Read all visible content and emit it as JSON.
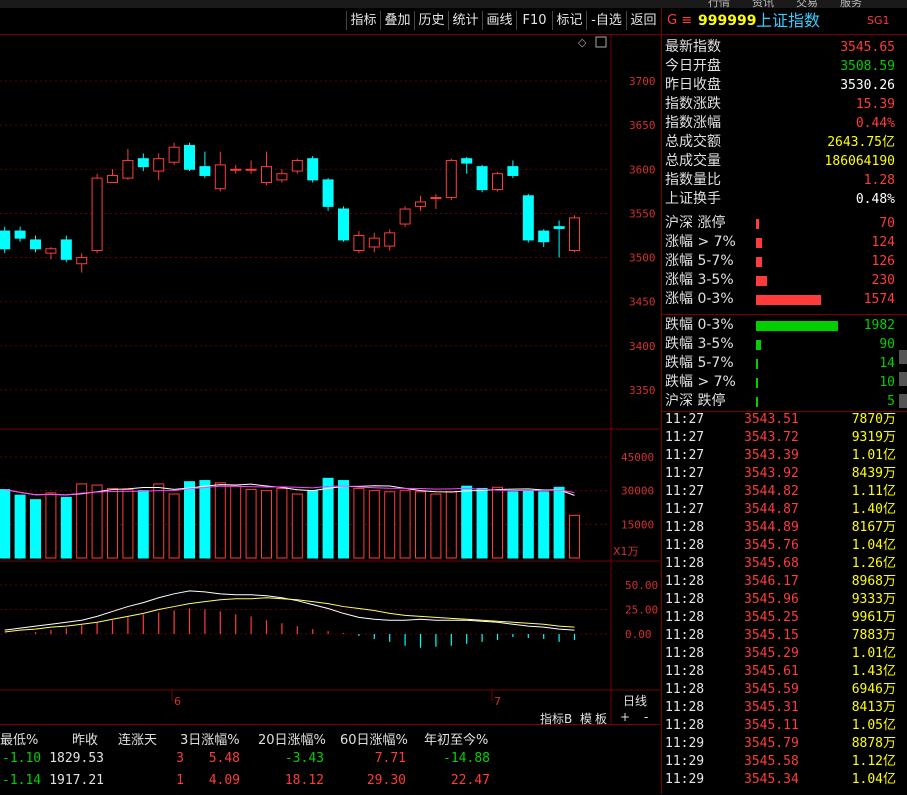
{
  "top_menu": [
    "行情",
    "资讯",
    "交易",
    "服务"
  ],
  "toolbar": [
    "指标",
    "叠加",
    "历史",
    "统计",
    "画线",
    "F10",
    "标记",
    "-自选",
    "返回"
  ],
  "colors": {
    "up": "#ff3b3b",
    "down": "#00ffff",
    "accent": "#ffff00",
    "green": "#00d000",
    "grid": "#7a0000"
  },
  "header": {
    "prefix": "G ≡",
    "code": "999999",
    "name": "上证指数",
    "tag": "SG1"
  },
  "stats": [
    {
      "label": "最新指数",
      "value": "3545.65",
      "color": "#ff3b3b"
    },
    {
      "label": "今日开盘",
      "value": "3508.59",
      "color": "#00d000"
    },
    {
      "label": "昨日收盘",
      "value": "3530.26",
      "color": "#ffffff"
    },
    {
      "label": "指数涨跌",
      "value": "15.39",
      "color": "#ff3b3b"
    },
    {
      "label": "指数涨幅",
      "value": "0.44%",
      "color": "#ff3b3b"
    },
    {
      "label": "总成交额",
      "value": "2643.75亿",
      "color": "#ffff00"
    },
    {
      "label": "总成交量",
      "value": "186064190",
      "color": "#ffff00"
    },
    {
      "label": "指数量比",
      "value": "1.28",
      "color": "#ff3b3b"
    },
    {
      "label": "上证换手",
      "value": "0.48%",
      "color": "#ffffff"
    }
  ],
  "breadth": [
    {
      "label": "沪深 涨停",
      "value": "70",
      "ratio": 0.02,
      "color": "#ff3b3b"
    },
    {
      "label": "涨幅 > 7%",
      "value": "124",
      "ratio": 0.04,
      "color": "#ff3b3b"
    },
    {
      "label": "涨幅 5-7%",
      "value": "126",
      "ratio": 0.04,
      "color": "#ff3b3b"
    },
    {
      "label": "涨幅 3-5%",
      "value": "230",
      "ratio": 0.07,
      "color": "#ff3b3b"
    },
    {
      "label": "涨幅 0-3%",
      "value": "1574",
      "ratio": 0.42,
      "color": "#ff3b3b"
    },
    {
      "label": "跌幅 0-3%",
      "value": "1982",
      "ratio": 0.53,
      "color": "#00d000"
    },
    {
      "label": "跌幅 3-5%",
      "value": "90",
      "ratio": 0.03,
      "color": "#00d000"
    },
    {
      "label": "跌幅 5-7%",
      "value": "14",
      "ratio": 0.01,
      "color": "#00d000"
    },
    {
      "label": "跌幅 > 7%",
      "value": "10",
      "ratio": 0.01,
      "color": "#00d000"
    },
    {
      "label": "沪深 跌停",
      "value": "5",
      "ratio": 0.01,
      "color": "#00d000"
    }
  ],
  "ticks": [
    {
      "t": "11:27",
      "p": "3543.51",
      "v": "7870万"
    },
    {
      "t": "11:27",
      "p": "3543.72",
      "v": "9319万"
    },
    {
      "t": "11:27",
      "p": "3543.39",
      "v": "1.01亿"
    },
    {
      "t": "11:27",
      "p": "3543.92",
      "v": "8439万"
    },
    {
      "t": "11:27",
      "p": "3544.82",
      "v": "1.11亿"
    },
    {
      "t": "11:27",
      "p": "3544.87",
      "v": "1.40亿"
    },
    {
      "t": "11:28",
      "p": "3544.89",
      "v": "8167万"
    },
    {
      "t": "11:28",
      "p": "3545.76",
      "v": "1.04亿"
    },
    {
      "t": "11:28",
      "p": "3545.68",
      "v": "1.26亿"
    },
    {
      "t": "11:28",
      "p": "3546.17",
      "v": "8968万"
    },
    {
      "t": "11:28",
      "p": "3545.96",
      "v": "9333万"
    },
    {
      "t": "11:28",
      "p": "3545.25",
      "v": "9961万"
    },
    {
      "t": "11:28",
      "p": "3545.15",
      "v": "7883万"
    },
    {
      "t": "11:28",
      "p": "3545.29",
      "v": "1.01亿"
    },
    {
      "t": "11:28",
      "p": "3545.61",
      "v": "1.43亿"
    },
    {
      "t": "11:28",
      "p": "3545.59",
      "v": "6946万"
    },
    {
      "t": "11:28",
      "p": "3545.31",
      "v": "8413万"
    },
    {
      "t": "11:28",
      "p": "3545.11",
      "v": "1.05亿"
    },
    {
      "t": "11:29",
      "p": "3545.79",
      "v": "8878万"
    },
    {
      "t": "11:29",
      "p": "3545.58",
      "v": "1.12亿"
    },
    {
      "t": "11:29",
      "p": "3545.34",
      "v": "1.04亿"
    }
  ],
  "chart_data": {
    "type": "candlestick",
    "price_axis": [
      3700,
      3650,
      3600,
      3550,
      3500,
      3450,
      3400,
      3350
    ],
    "volume_axis": [
      "45000",
      "30000",
      "15000"
    ],
    "volume_unit": "X1万",
    "macd_axis": [
      "50.00",
      "25.00",
      "0.00"
    ],
    "x_labels": [
      "6",
      "7"
    ],
    "period": "日线",
    "candles": [
      {
        "o": 3530,
        "c": 3510,
        "h": 3535,
        "l": 3505
      },
      {
        "o": 3530,
        "c": 3522,
        "h": 3535,
        "l": 3518
      },
      {
        "o": 3520,
        "c": 3510,
        "h": 3525,
        "l": 3506
      },
      {
        "o": 3505,
        "c": 3510,
        "h": 3512,
        "l": 3498
      },
      {
        "o": 3520,
        "c": 3498,
        "h": 3525,
        "l": 3495
      },
      {
        "o": 3493,
        "c": 3500,
        "h": 3505,
        "l": 3483
      },
      {
        "o": 3508,
        "c": 3590,
        "h": 3595,
        "l": 3505
      },
      {
        "o": 3585,
        "c": 3593,
        "h": 3600,
        "l": 3585
      },
      {
        "o": 3590,
        "c": 3610,
        "h": 3623,
        "l": 3588
      },
      {
        "o": 3612,
        "c": 3603,
        "h": 3618,
        "l": 3598
      },
      {
        "o": 3598,
        "c": 3612,
        "h": 3618,
        "l": 3588
      },
      {
        "o": 3608,
        "c": 3625,
        "h": 3630,
        "l": 3605
      },
      {
        "o": 3627,
        "c": 3600,
        "h": 3630,
        "l": 3598
      },
      {
        "o": 3603,
        "c": 3593,
        "h": 3620,
        "l": 3590
      },
      {
        "o": 3578,
        "c": 3605,
        "h": 3620,
        "l": 3575
      },
      {
        "o": 3600,
        "c": 3600,
        "h": 3605,
        "l": 3595
      },
      {
        "o": 3600,
        "c": 3600,
        "h": 3610,
        "l": 3595
      },
      {
        "o": 3585,
        "c": 3603,
        "h": 3620,
        "l": 3582
      },
      {
        "o": 3588,
        "c": 3595,
        "h": 3600,
        "l": 3585
      },
      {
        "o": 3598,
        "c": 3610,
        "h": 3612,
        "l": 3595
      },
      {
        "o": 3612,
        "c": 3588,
        "h": 3615,
        "l": 3585
      },
      {
        "o": 3588,
        "c": 3558,
        "h": 3590,
        "l": 3553
      },
      {
        "o": 3555,
        "c": 3520,
        "h": 3558,
        "l": 3518
      },
      {
        "o": 3508,
        "c": 3525,
        "h": 3530,
        "l": 3505
      },
      {
        "o": 3512,
        "c": 3522,
        "h": 3528,
        "l": 3506
      },
      {
        "o": 3513,
        "c": 3528,
        "h": 3532,
        "l": 3508
      },
      {
        "o": 3538,
        "c": 3555,
        "h": 3558,
        "l": 3535
      },
      {
        "o": 3558,
        "c": 3563,
        "h": 3570,
        "l": 3553
      },
      {
        "o": 3568,
        "c": 3568,
        "h": 3572,
        "l": 3555
      },
      {
        "o": 3568,
        "c": 3610,
        "h": 3612,
        "l": 3565
      },
      {
        "o": 3612,
        "c": 3607,
        "h": 3614,
        "l": 3595
      },
      {
        "o": 3603,
        "c": 3577,
        "h": 3605,
        "l": 3574
      },
      {
        "o": 3577,
        "c": 3595,
        "h": 3597,
        "l": 3575
      },
      {
        "o": 3603,
        "c": 3593,
        "h": 3610,
        "l": 3590
      },
      {
        "o": 3570,
        "c": 3520,
        "h": 3572,
        "l": 3517
      },
      {
        "o": 3530,
        "c": 3518,
        "h": 3532,
        "l": 3512
      },
      {
        "o": 3535,
        "c": 3533,
        "h": 3542,
        "l": 3500
      },
      {
        "o": 3508,
        "c": 3545,
        "h": 3548,
        "l": 3506
      }
    ],
    "volumes": [
      30500,
      28000,
      26000,
      29000,
      27000,
      33000,
      32500,
      31000,
      30500,
      30000,
      33000,
      28500,
      34000,
      34500,
      33500,
      32000,
      30500,
      30000,
      31000,
      28500,
      30000,
      35500,
      34500,
      31000,
      30000,
      29500,
      30000,
      29500,
      28500,
      29500,
      32000,
      31000,
      31500,
      29500,
      30000,
      29500,
      31500,
      19000
    ],
    "macd_hist": [
      0,
      0,
      2,
      4,
      6,
      9,
      12,
      14,
      17,
      20,
      22,
      24,
      26,
      25,
      23,
      20,
      18,
      14,
      11,
      8,
      5,
      3,
      1,
      -2,
      -5,
      -8,
      -12,
      -14,
      -13,
      -12,
      -10,
      -8,
      -6,
      -3,
      -4,
      -5,
      -8,
      -6
    ],
    "dif": [
      4,
      6,
      8,
      10,
      12,
      14,
      18,
      23,
      28,
      32,
      37,
      41,
      44,
      43,
      41,
      40,
      40,
      39,
      37,
      34,
      30,
      26,
      21,
      17,
      15,
      14,
      14,
      15,
      14,
      14,
      14,
      13,
      12,
      10,
      8,
      7,
      5,
      4
    ],
    "dea": [
      2,
      4,
      5,
      7,
      8,
      10,
      12,
      15,
      18,
      21,
      25,
      28,
      31,
      33,
      35,
      36,
      36,
      37,
      36,
      35,
      33,
      31,
      28,
      26,
      24,
      21,
      19,
      18,
      17,
      16,
      15,
      14,
      13,
      12,
      11,
      10,
      8,
      7
    ]
  },
  "bottom": {
    "headers": [
      "最低%",
      "昨收",
      "连涨天",
      "3日涨幅%",
      "20日涨幅%",
      "60日涨幅%",
      "年初至今%"
    ],
    "rows": [
      [
        {
          "v": "-1.10",
          "c": "#00d000"
        },
        {
          "v": "1829.53",
          "c": "#e0e0e0"
        },
        {
          "v": "3",
          "c": "#ff3b3b"
        },
        {
          "v": "5.48",
          "c": "#ff3b3b"
        },
        {
          "v": "-3.43",
          "c": "#00d000"
        },
        {
          "v": "7.71",
          "c": "#ff3b3b"
        },
        {
          "v": "-14.88",
          "c": "#00d000"
        }
      ],
      [
        {
          "v": "-1.14",
          "c": "#00d000"
        },
        {
          "v": "1917.21",
          "c": "#e0e0e0"
        },
        {
          "v": "1",
          "c": "#ff3b3b"
        },
        {
          "v": "4.09",
          "c": "#ff3b3b"
        },
        {
          "v": "18.12",
          "c": "#ff3b3b"
        },
        {
          "v": "29.30",
          "c": "#ff3b3b"
        },
        {
          "v": "22.47",
          "c": "#ff3b3b"
        }
      ]
    ],
    "tabs": [
      "指标B",
      "模",
      "板",
      "+",
      "-"
    ]
  }
}
